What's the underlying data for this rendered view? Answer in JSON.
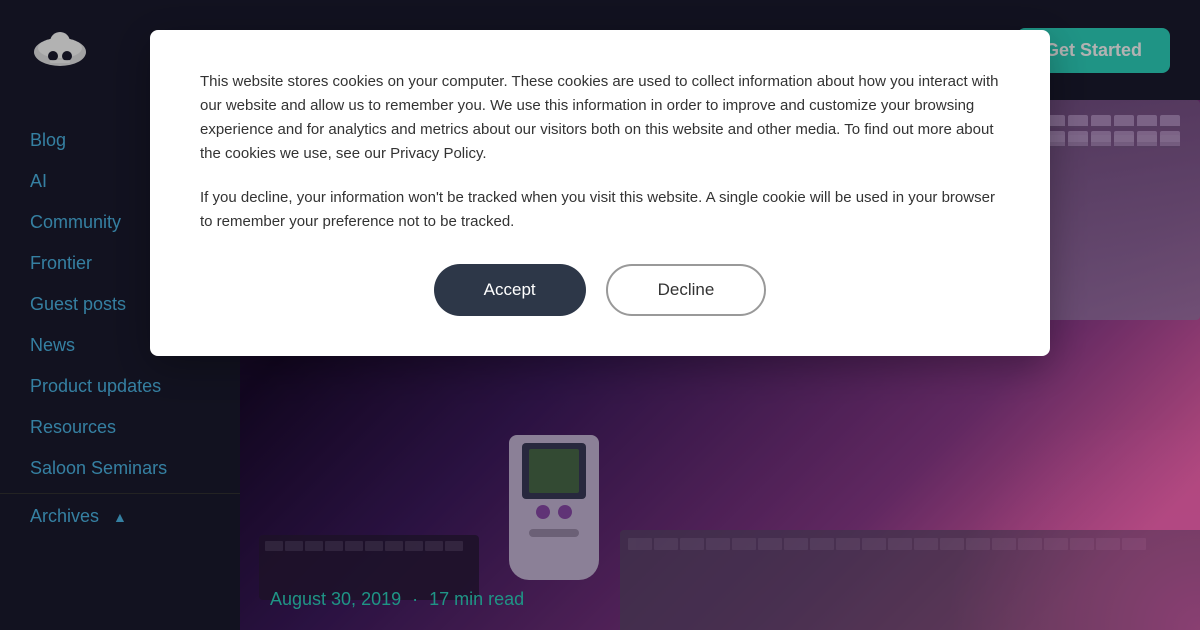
{
  "header": {
    "get_started_label": "Get Started"
  },
  "sidebar": {
    "items": [
      {
        "id": "blog",
        "label": "Blog"
      },
      {
        "id": "ai",
        "label": "AI"
      },
      {
        "id": "community",
        "label": "Community"
      },
      {
        "id": "frontier",
        "label": "Frontier"
      },
      {
        "id": "guest-posts",
        "label": "Guest posts"
      },
      {
        "id": "news",
        "label": "News"
      },
      {
        "id": "product-updates",
        "label": "Product updates"
      },
      {
        "id": "resources",
        "label": "Resources"
      },
      {
        "id": "saloon-seminars",
        "label": "Saloon Seminars"
      },
      {
        "id": "archives",
        "label": "Archives",
        "hasChevron": true
      }
    ]
  },
  "hero": {
    "date": "August 30, 2019",
    "read_time": "17 min read",
    "date_separator": "·"
  },
  "cookie_modal": {
    "paragraph1": "This website stores cookies on your computer. These cookies are used to collect information about how you interact with our website and allow us to remember you. We use this information in order to improve and customize your browsing experience and for analytics and metrics about our visitors both on this website and other media. To find out more about the cookies we use, see our Privacy Policy.",
    "paragraph2": "If you decline, your information won't be tracked when you visit this website. A single cookie will be used in your browser to remember your preference not to be tracked.",
    "accept_label": "Accept",
    "decline_label": "Decline"
  }
}
